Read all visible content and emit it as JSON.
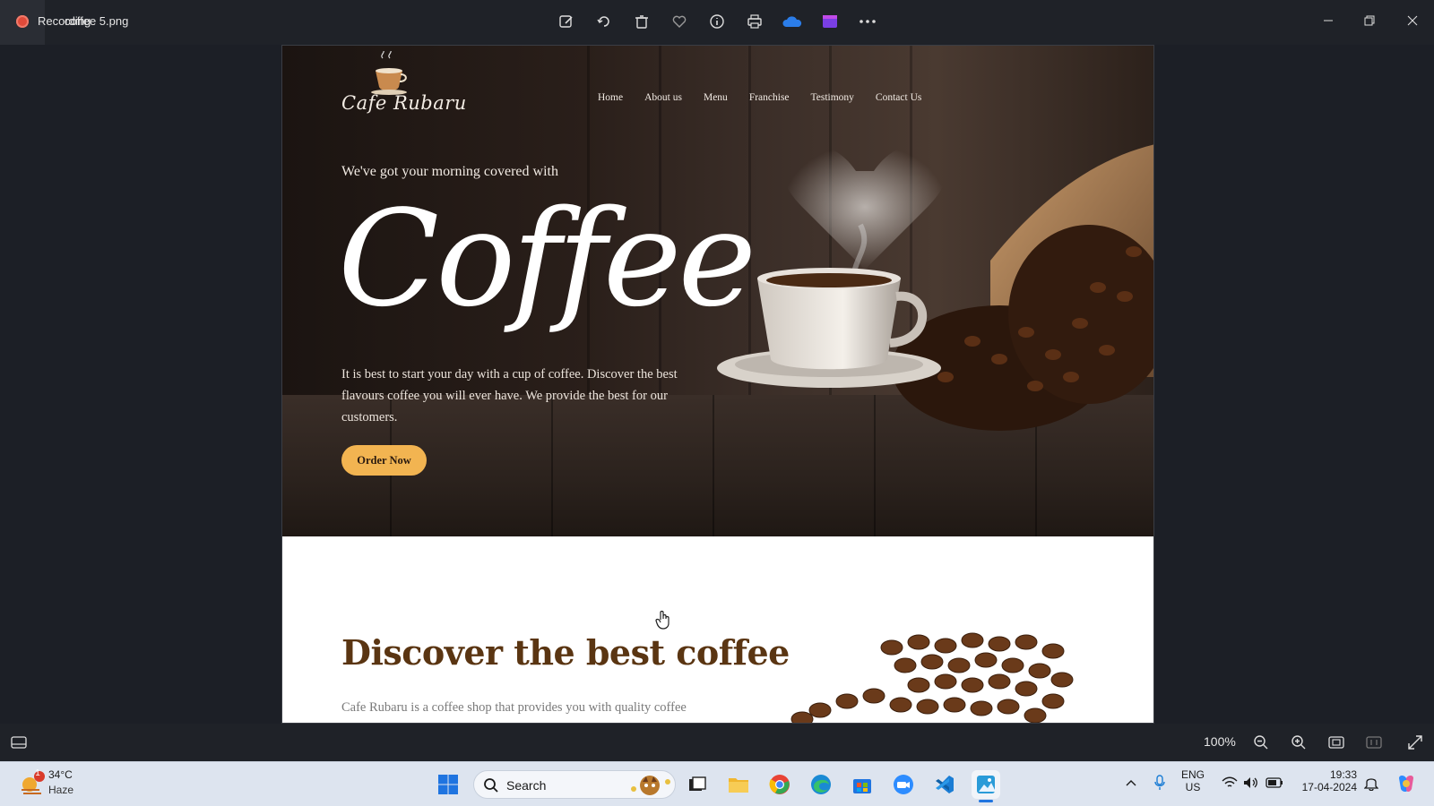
{
  "window": {
    "title_overlap_a": "Recording",
    "title_overlap_b": "coffee 5.png",
    "toolbar_icons": [
      "edit-icon",
      "rotate-icon",
      "delete-icon",
      "favorite-icon",
      "info-icon",
      "print-icon",
      "onedrive-icon",
      "clipchamp-icon",
      "more-icon"
    ],
    "controls": [
      "minimize",
      "restore",
      "close"
    ]
  },
  "site": {
    "brand": "Cafe Rubaru",
    "nav": [
      "Home",
      "About us",
      "Menu",
      "Franchise",
      "Testimony",
      "Contact Us"
    ],
    "tagline": "We've got your morning covered with",
    "hero_word": "Coffee",
    "hero_desc": "It is best to start your day with a cup of coffee. Discover the best flavours coffee you will ever have. We provide the best for our customers.",
    "cta": "Order Now",
    "discover_title": "Discover the best coffee",
    "discover_desc": "Cafe Rubaru is a coffee shop that provides you with quality coffee"
  },
  "viewer": {
    "zoom": "100%"
  },
  "taskbar": {
    "weather_badge": "1",
    "weather_temp": "34°C",
    "weather_cond": "Haze",
    "search_label": "Search",
    "lang_top": "ENG",
    "lang_bottom": "US",
    "time": "19:33",
    "date": "17-04-2024"
  },
  "colors": {
    "accent_button": "#f2b451",
    "discover_title": "#5a3512",
    "hero_dark": "#1b1411"
  }
}
